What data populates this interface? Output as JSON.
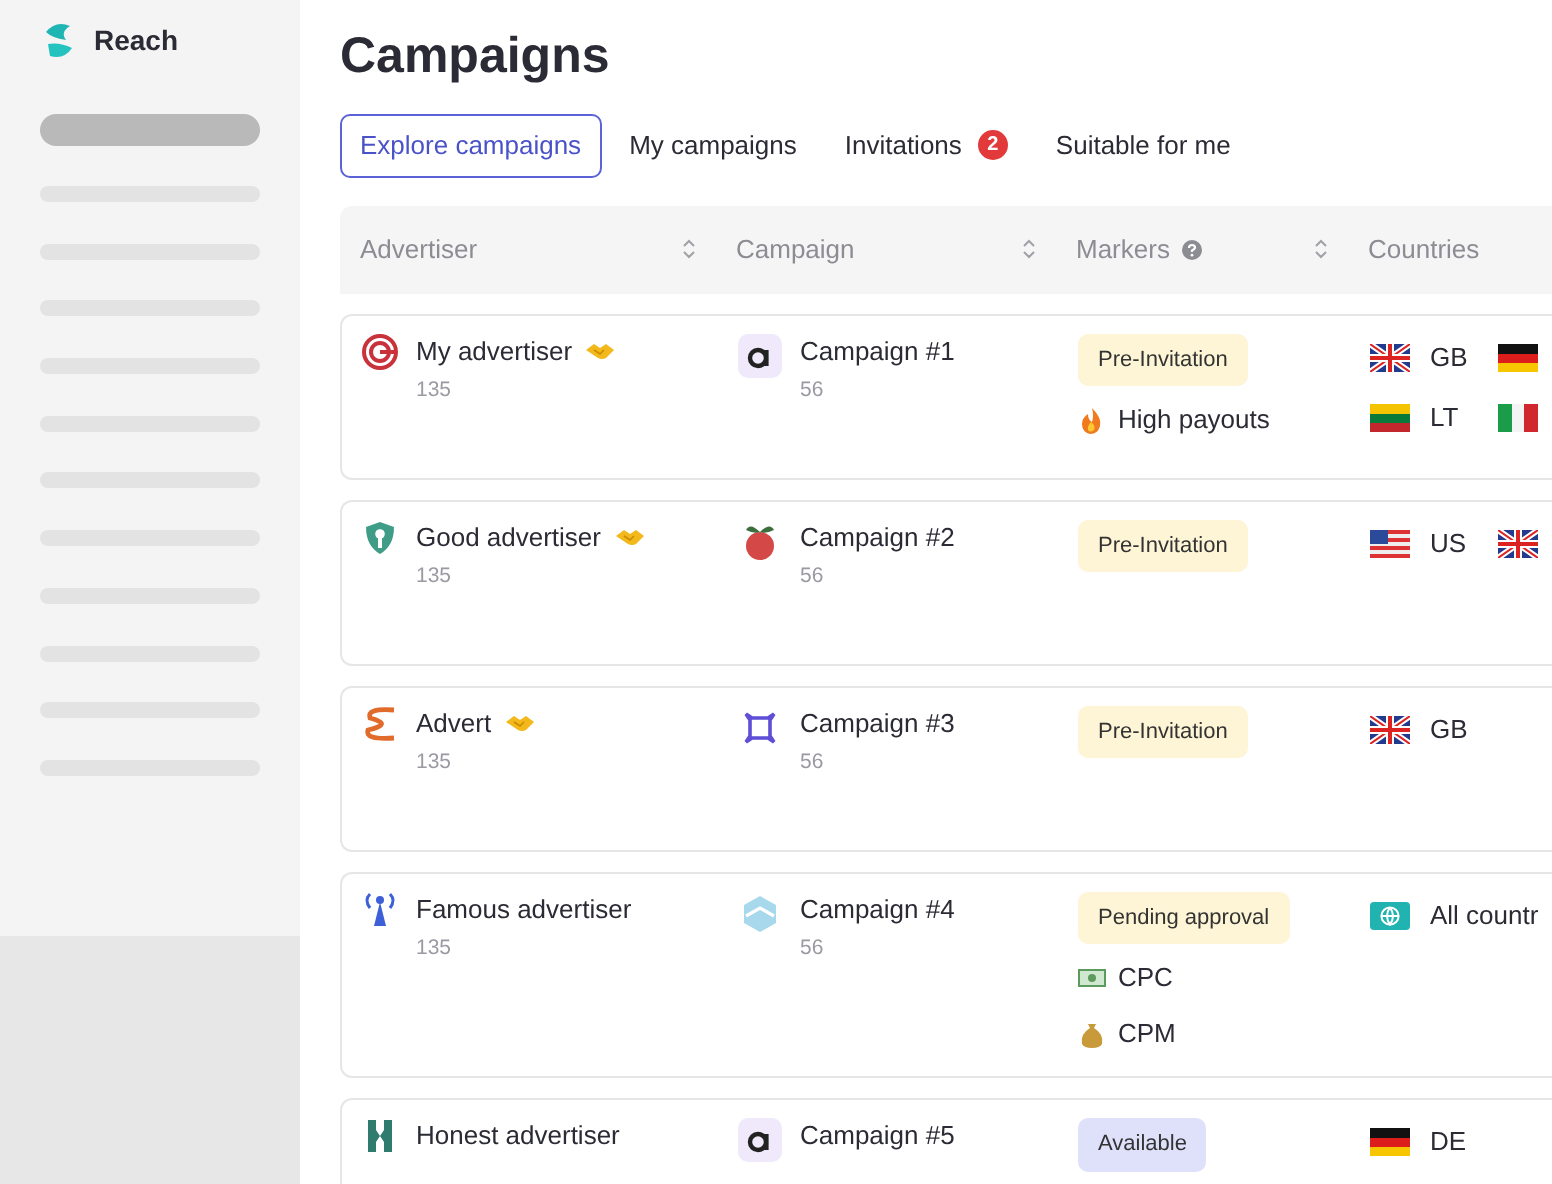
{
  "app": {
    "name": "Reach"
  },
  "sidebar": {
    "items": [
      {
        "selected": true
      },
      {
        "selected": false
      },
      {
        "selected": false
      },
      {
        "selected": false
      },
      {
        "selected": false
      },
      {
        "selected": false
      },
      {
        "selected": false
      },
      {
        "selected": false
      },
      {
        "selected": false
      },
      {
        "selected": false
      },
      {
        "selected": false
      },
      {
        "selected": false
      }
    ]
  },
  "page": {
    "title": "Campaigns"
  },
  "tabs": [
    {
      "label": "Explore campaigns",
      "selected": true
    },
    {
      "label": "My campaigns",
      "selected": false
    },
    {
      "label": "Invitations",
      "selected": false,
      "badge": "2"
    },
    {
      "label": "Suitable for me",
      "selected": false
    }
  ],
  "table": {
    "columns": [
      {
        "label": "Advertiser",
        "sortable": true
      },
      {
        "label": "Campaign",
        "sortable": true
      },
      {
        "label": "Markers",
        "help": true,
        "sortable": true
      },
      {
        "label": "Countries",
        "sortable": false
      }
    ],
    "rows": [
      {
        "advertiser": {
          "kind": "target",
          "name": "My advertiser",
          "partner": true,
          "count": "135"
        },
        "campaign": {
          "kind": "letter",
          "name": "Campaign #1",
          "count": "56"
        },
        "markers": [
          {
            "kind": "badge",
            "label": "Pre-Invitation",
            "color": "#fdf5d6"
          },
          {
            "kind": "fire",
            "label": "High payouts"
          }
        ],
        "countries": [
          {
            "kind": "gb",
            "code": "GB"
          },
          {
            "kind": "de"
          },
          {
            "kind": "lt",
            "code": "LT"
          },
          {
            "kind": "it"
          }
        ]
      },
      {
        "advertiser": {
          "kind": "shield",
          "name": "Good advertiser",
          "partner": true,
          "count": "135"
        },
        "campaign": {
          "kind": "fruit",
          "name": "Campaign #2",
          "count": "56"
        },
        "markers": [
          {
            "kind": "badge",
            "label": "Pre-Invitation",
            "color": "#fdf5d6"
          }
        ],
        "countries": [
          {
            "kind": "us",
            "code": "US"
          },
          {
            "kind": "gb"
          }
        ]
      },
      {
        "advertiser": {
          "kind": "squiggle",
          "name": "Advert",
          "partner": true,
          "count": "135"
        },
        "campaign": {
          "kind": "frame",
          "name": "Campaign #3",
          "count": "56"
        },
        "markers": [
          {
            "kind": "badge",
            "label": "Pre-Invitation",
            "color": "#fdf5d6"
          }
        ],
        "countries": [
          {
            "kind": "gb",
            "code": "GB"
          }
        ]
      },
      {
        "advertiser": {
          "kind": "tower",
          "name": "Famous advertiser",
          "partner": false,
          "count": "135"
        },
        "campaign": {
          "kind": "hexagon",
          "name": "Campaign #4",
          "count": "56"
        },
        "markers": [
          {
            "kind": "badge",
            "label": "Pending approval",
            "color": "#fdf5d6"
          },
          {
            "kind": "banknote",
            "label": "CPC"
          },
          {
            "kind": "moneybag",
            "label": "CPM"
          }
        ],
        "countries": [
          {
            "kind": "globe",
            "code": "All countr"
          }
        ]
      },
      {
        "advertiser": {
          "kind": "hourglass",
          "name": "Honest advertiser",
          "partner": false
        },
        "campaign": {
          "kind": "letter",
          "name": "Campaign #5"
        },
        "markers": [
          {
            "kind": "badge",
            "label": "Available",
            "color": "#dfe1fb"
          }
        ],
        "countries": [
          {
            "kind": "de",
            "code": "DE"
          }
        ]
      }
    ]
  }
}
